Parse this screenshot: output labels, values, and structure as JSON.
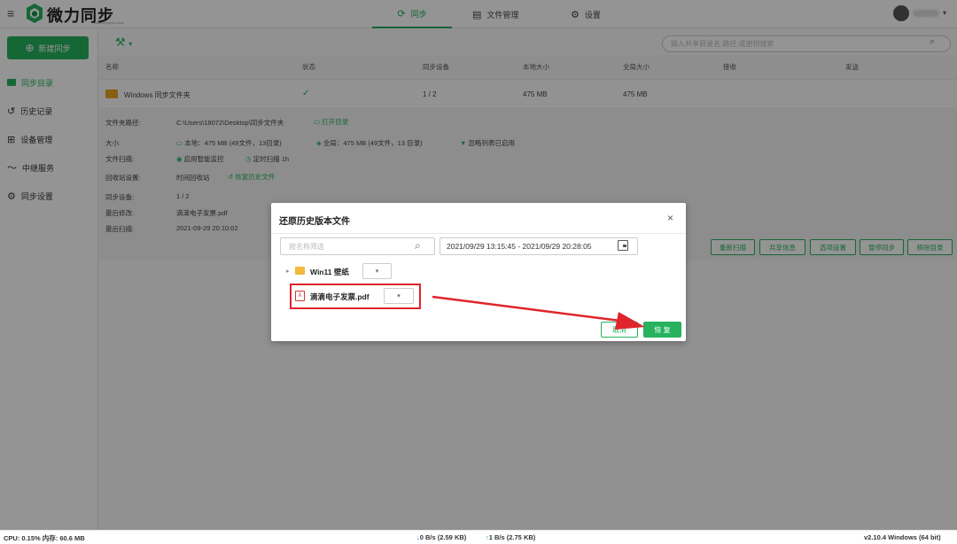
{
  "app": {
    "logo_text": "微力同步",
    "logo_url": "www.verysync.com"
  },
  "nav": [
    {
      "label": "同步",
      "icon": "sync-icon"
    },
    {
      "label": "文件管理",
      "icon": "file-icon"
    },
    {
      "label": "设置",
      "icon": "gear-icon"
    }
  ],
  "sidebar": {
    "new_button": "新建同步",
    "items": [
      {
        "label": "同步目录",
        "icon": "folder-icon"
      },
      {
        "label": "历史记录",
        "icon": "history-icon"
      },
      {
        "label": "设备管理",
        "icon": "devices-icon"
      },
      {
        "label": "中继服务",
        "icon": "relay-icon"
      },
      {
        "label": "同步设置",
        "icon": "gear-icon"
      }
    ]
  },
  "search": {
    "placeholder": "输入共享目录名,路径,或密钥搜索"
  },
  "table": {
    "headers": [
      "名称",
      "状态",
      "同步设备",
      "本地大小",
      "全局大小",
      "接收",
      "发送"
    ],
    "row": {
      "name": "Windows 同步文件夹",
      "status": "✓",
      "devices": "1 / 2",
      "local": "475 MB",
      "global": "475 MB",
      "recv": "",
      "send": ""
    }
  },
  "detail": {
    "path_label": "文件夹路径:",
    "path": "C:\\Users\\18072\\Desktop\\同步文件夹",
    "open_dir": "打开目录",
    "size_label": "大小:",
    "size_local": "本地：475 MB (49文件，13目录)",
    "size_global": "全局：475 MB (49文件，13 目录)",
    "ignore": "忽略列表已启用",
    "scan_label": "文件扫描:",
    "scan_smart": "启用智能监控",
    "scan_timer": "定时扫描 1h",
    "recycle_label": "回收站设置:",
    "recycle": "时间回收站",
    "restore_hist": "恢复历史文件",
    "devices_label": "同步设备:",
    "devices": "1 / 2",
    "modified_label": "最后修改:",
    "modified": "滴滴电子发票.pdf",
    "scanned_label": "最后扫描:",
    "scanned": "2021-09-29 20:10:02"
  },
  "actions": [
    "重新扫描",
    "共享信息",
    "选项设置",
    "暂停同步",
    "移除目录"
  ],
  "modal": {
    "title": "还原历史版本文件",
    "close": "×",
    "filter_placeholder": "按名称筛选",
    "date_range": "2021/09/29 13:15:45 - 2021/09/29 20:28:05",
    "items": [
      {
        "name": "Win11 壁纸",
        "type": "folder"
      },
      {
        "name": "滴滴电子发票.pdf",
        "type": "pdf"
      }
    ],
    "cancel": "取消",
    "restore": "恢 复"
  },
  "statusbar": {
    "cpu": "CPU: 0.15%  内存: 60.6 MB",
    "down": "0 B/s (2.59 KB)",
    "up": "1 B/s (2.75 KB)",
    "version": "v2.10.4  Windows (64 bit)"
  },
  "colors": {
    "accent": "#27b25e",
    "highlight": "#e0242c"
  }
}
